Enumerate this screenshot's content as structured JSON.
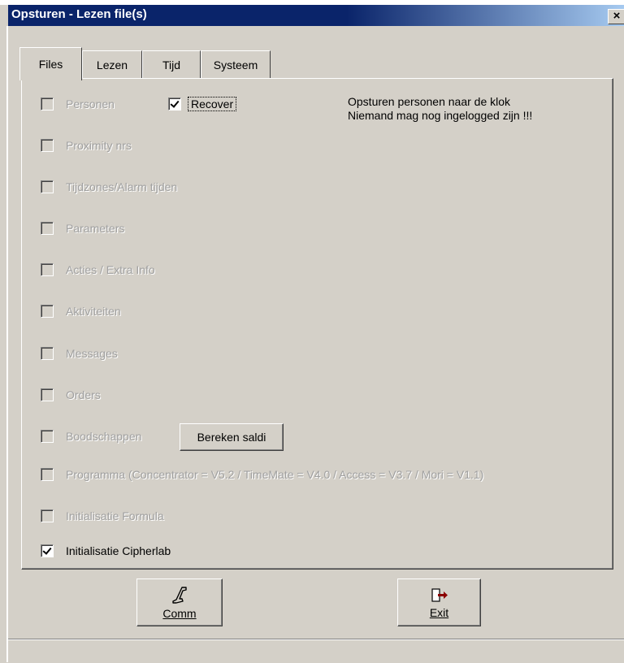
{
  "window": {
    "title": "Opsturen - Lezen  file(s)",
    "close": "×"
  },
  "tabs": [
    "Files",
    "Lezen",
    "Tijd",
    "Systeem"
  ],
  "message": [
    "Opsturen personen naar de klok",
    "Niemand mag nog ingelogged zijn !!!"
  ],
  "checkboxes": [
    {
      "label": "Personen",
      "checked": false,
      "enabled": false
    },
    {
      "label": "Recover",
      "checked": true,
      "enabled": true
    },
    {
      "label": "Proximity nrs",
      "checked": false,
      "enabled": false
    },
    {
      "label": "Tijdzones/Alarm tijden",
      "checked": false,
      "enabled": false
    },
    {
      "label": "Parameters",
      "checked": false,
      "enabled": false
    },
    {
      "label": "Acties / Extra Info",
      "checked": false,
      "enabled": false
    },
    {
      "label": "Aktiviteiten",
      "checked": false,
      "enabled": false
    },
    {
      "label": "Messages",
      "checked": false,
      "enabled": false
    },
    {
      "label": "Orders",
      "checked": false,
      "enabled": false
    },
    {
      "label": "Boodschappen",
      "checked": false,
      "enabled": false
    },
    {
      "label": "Programma (Concentrator = V5.2 / TimeMate = V4.0 / Access = V3.7 / Mori = V1.1)",
      "checked": false,
      "enabled": false
    },
    {
      "label": "Initialisatie Formula",
      "checked": false,
      "enabled": false
    },
    {
      "label": "Initialisatie Cipherlab",
      "checked": true,
      "enabled": true
    }
  ],
  "buttons": {
    "bereken": "Bereken saldi",
    "comm": "Comm",
    "exit": "Exit"
  },
  "colors": {
    "title_bar": "#0a246a",
    "window_bg": "#d4d0c8",
    "exit_icon": "#8b0000"
  },
  "icons": {
    "comm": "phone-handset-icon",
    "exit": "exit-door-icon"
  }
}
